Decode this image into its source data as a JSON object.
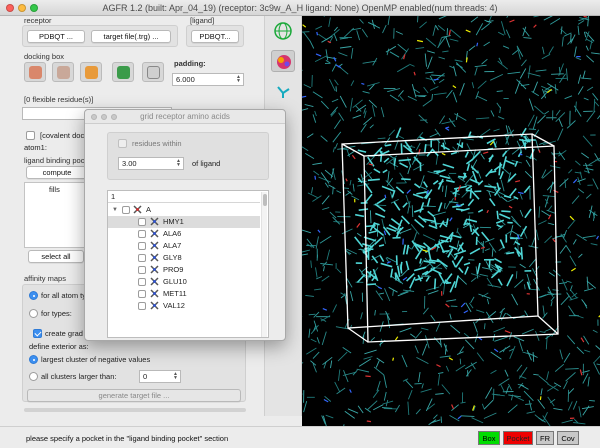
{
  "window": {
    "title": "AGFR 1.2 (built: Apr_04_19) (receptor: 3c9w_A_H ligand: None) OpenMP enabled(num threads: 4)"
  },
  "left": {
    "receptor_label": "receptor",
    "receptor_button": "PDBQT ...",
    "target_button": "target file(.trg) ...",
    "ligand_label": "[ligand]",
    "ligand_button": "PDBQT...",
    "docking_box_label": "docking box",
    "padding_label": "padding:",
    "padding_value": "6.000",
    "flex_label": "[0 flexible residue(s)]",
    "covalent_label": "[covalent doc",
    "atom1_label": "atom1:",
    "pocket_label": "ligand binding pock",
    "compute_button": "compute",
    "fills_header": "fills",
    "select_all_button": "select all",
    "affinity_label": "affinity maps",
    "for_all_atom_label": "for all atom ty",
    "for_types_label": "for types:",
    "create_grad_label": "create grad",
    "define_exterior_label": "define exterior as:",
    "largest_cluster_label": "largest cluster of negative values",
    "all_clusters_label": "all clusters larger than:",
    "clusters_value": "0",
    "generate_button": "generate target file ..."
  },
  "dialog": {
    "title": "grid receptor amino acids",
    "residues_within_label": "residues within",
    "distance_value": "3.00",
    "of_ligand_label": "of ligand",
    "list_header": "1",
    "chain": "A",
    "residues": [
      "HMY1",
      "ALA6",
      "ALA7",
      "GLY8",
      "PRO9",
      "GLU10",
      "MET11",
      "VAL12"
    ],
    "selected_index": 0
  },
  "status": {
    "message": "please specify a pocket in the \"ligand binding pocket\" section",
    "tags": [
      {
        "label": "Box",
        "color": "#00dd00",
        "text_color": "#000000"
      },
      {
        "label": "Pocket",
        "color": "#ee0000",
        "text_color": "#222222"
      },
      {
        "label": "FR",
        "color": "#c8c8c8",
        "text_color": "#000000"
      },
      {
        "label": "Cov",
        "color": "#c8c8c8",
        "text_color": "#000000"
      }
    ]
  },
  "icons": {
    "toolbar": [
      "box-center-icon",
      "box-shrink-icon",
      "box-ligand-icon",
      "box-zoom-icon",
      "box-expand-icon"
    ],
    "strip": [
      "globe-icon",
      "molecule-icon",
      "bond-icon"
    ]
  }
}
